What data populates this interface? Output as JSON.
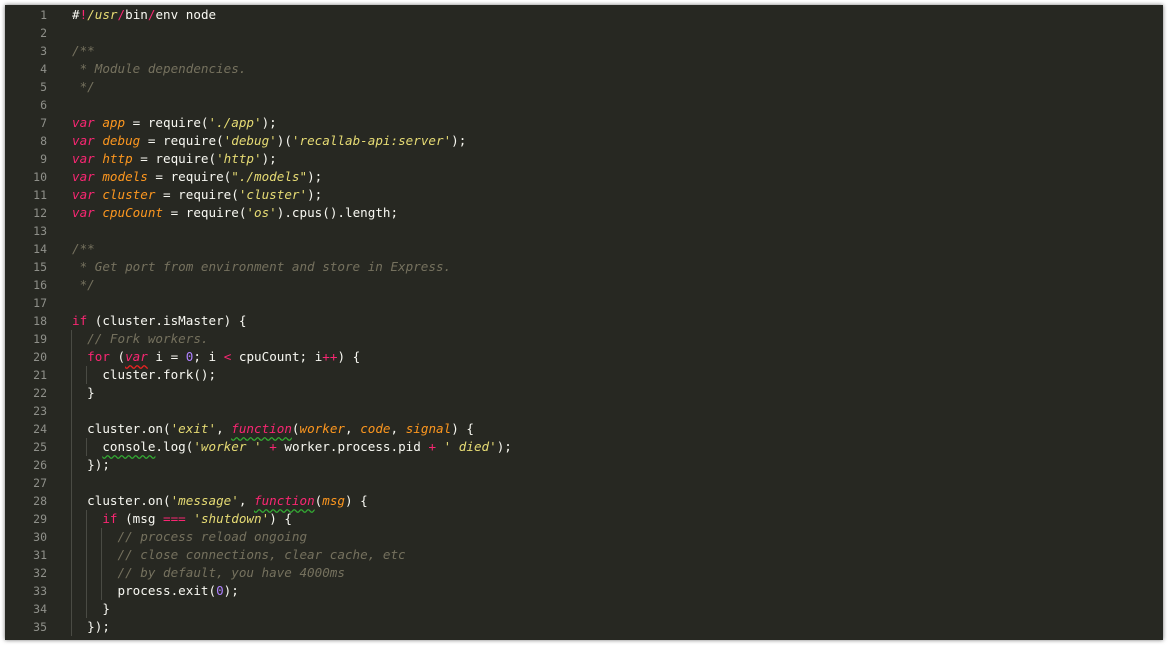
{
  "colors": {
    "background": "#272822",
    "default": "#f8f8f2",
    "keyword": "#f92672",
    "storage": "#f92672",
    "string": "#e6db74",
    "comment": "#75715e",
    "param": "#fd971f",
    "number": "#ae81ff",
    "linenumber": "#8f908a"
  },
  "editor": {
    "lines": [
      {
        "num": "1",
        "tokens": [
          {
            "t": "#",
            "c": "default"
          },
          {
            "t": "!",
            "c": "keyword"
          },
          {
            "t": "/usr",
            "c": "string"
          },
          {
            "t": "/",
            "c": "keyword"
          },
          {
            "t": "bin",
            "c": "default"
          },
          {
            "t": "/",
            "c": "keyword"
          },
          {
            "t": "env node",
            "c": "default"
          }
        ]
      },
      {
        "num": "2",
        "tokens": []
      },
      {
        "num": "3",
        "tokens": [
          {
            "t": "/**",
            "c": "comment"
          }
        ]
      },
      {
        "num": "4",
        "tokens": [
          {
            "t": " * Module dependencies.",
            "c": "comment"
          }
        ]
      },
      {
        "num": "5",
        "tokens": [
          {
            "t": " */",
            "c": "comment"
          }
        ]
      },
      {
        "num": "6",
        "tokens": []
      },
      {
        "num": "7",
        "tokens": [
          {
            "t": "var",
            "c": "storage"
          },
          {
            "t": " ",
            "c": "default"
          },
          {
            "t": "app",
            "c": "param"
          },
          {
            "t": " = require(",
            "c": "default"
          },
          {
            "t": "'./app'",
            "c": "string"
          },
          {
            "t": ");",
            "c": "default"
          }
        ]
      },
      {
        "num": "8",
        "tokens": [
          {
            "t": "var",
            "c": "storage"
          },
          {
            "t": " ",
            "c": "default"
          },
          {
            "t": "debug",
            "c": "param"
          },
          {
            "t": " = require(",
            "c": "default"
          },
          {
            "t": "'debug'",
            "c": "string"
          },
          {
            "t": ")(",
            "c": "default"
          },
          {
            "t": "'recallab-api:server'",
            "c": "string"
          },
          {
            "t": ");",
            "c": "default"
          }
        ]
      },
      {
        "num": "9",
        "tokens": [
          {
            "t": "var",
            "c": "storage"
          },
          {
            "t": " ",
            "c": "default"
          },
          {
            "t": "http",
            "c": "param"
          },
          {
            "t": " = require(",
            "c": "default"
          },
          {
            "t": "'http'",
            "c": "string"
          },
          {
            "t": ");",
            "c": "default"
          }
        ]
      },
      {
        "num": "10",
        "tokens": [
          {
            "t": "var",
            "c": "storage"
          },
          {
            "t": " ",
            "c": "default"
          },
          {
            "t": "models",
            "c": "param"
          },
          {
            "t": " = require(",
            "c": "default"
          },
          {
            "t": "\"./models\"",
            "c": "string"
          },
          {
            "t": ");",
            "c": "default"
          }
        ]
      },
      {
        "num": "11",
        "tokens": [
          {
            "t": "var",
            "c": "storage"
          },
          {
            "t": " ",
            "c": "default"
          },
          {
            "t": "cluster",
            "c": "param"
          },
          {
            "t": " = require(",
            "c": "default"
          },
          {
            "t": "'cluster'",
            "c": "string"
          },
          {
            "t": ");",
            "c": "default"
          }
        ]
      },
      {
        "num": "12",
        "tokens": [
          {
            "t": "var",
            "c": "storage"
          },
          {
            "t": " ",
            "c": "default"
          },
          {
            "t": "cpuCount",
            "c": "param"
          },
          {
            "t": " = require(",
            "c": "default"
          },
          {
            "t": "'os'",
            "c": "string"
          },
          {
            "t": ").cpus().length;",
            "c": "default"
          }
        ]
      },
      {
        "num": "13",
        "tokens": []
      },
      {
        "num": "14",
        "tokens": [
          {
            "t": "/**",
            "c": "comment"
          }
        ]
      },
      {
        "num": "15",
        "tokens": [
          {
            "t": " * Get port from environment and store in Express.",
            "c": "comment"
          }
        ]
      },
      {
        "num": "16",
        "tokens": [
          {
            "t": " */",
            "c": "comment"
          }
        ]
      },
      {
        "num": "17",
        "tokens": []
      },
      {
        "num": "18",
        "tokens": [
          {
            "t": "if",
            "c": "keyword"
          },
          {
            "t": " (cluster.isMaster) {",
            "c": "default"
          }
        ]
      },
      {
        "num": "19",
        "tokens": [
          {
            "t": "  ",
            "c": "default"
          },
          {
            "t": "// Fork workers.",
            "c": "comment"
          }
        ]
      },
      {
        "num": "20",
        "tokens": [
          {
            "t": "  ",
            "c": "default"
          },
          {
            "t": "for",
            "c": "keyword"
          },
          {
            "t": " (",
            "c": "default"
          },
          {
            "t": "var",
            "c": "storage",
            "s": "r"
          },
          {
            "t": " i = ",
            "c": "default"
          },
          {
            "t": "0",
            "c": "number"
          },
          {
            "t": "; i ",
            "c": "default"
          },
          {
            "t": "<",
            "c": "keyword"
          },
          {
            "t": " cpuCount; i",
            "c": "default"
          },
          {
            "t": "++",
            "c": "keyword"
          },
          {
            "t": ") {",
            "c": "default"
          }
        ]
      },
      {
        "num": "21",
        "tokens": [
          {
            "t": "    cluster.fork();",
            "c": "default"
          }
        ]
      },
      {
        "num": "22",
        "tokens": [
          {
            "t": "  }",
            "c": "default"
          }
        ]
      },
      {
        "num": "23",
        "tokens": []
      },
      {
        "num": "24",
        "tokens": [
          {
            "t": "  cluster.on(",
            "c": "default"
          },
          {
            "t": "'exit'",
            "c": "string"
          },
          {
            "t": ", ",
            "c": "default"
          },
          {
            "t": "function",
            "c": "storage",
            "s": "g"
          },
          {
            "t": "(",
            "c": "default"
          },
          {
            "t": "worker",
            "c": "param"
          },
          {
            "t": ", ",
            "c": "default"
          },
          {
            "t": "code",
            "c": "param"
          },
          {
            "t": ", ",
            "c": "default"
          },
          {
            "t": "signal",
            "c": "param"
          },
          {
            "t": ") {",
            "c": "default"
          }
        ]
      },
      {
        "num": "25",
        "tokens": [
          {
            "t": "    ",
            "c": "default"
          },
          {
            "t": "console",
            "c": "default",
            "s": "g"
          },
          {
            "t": ".log(",
            "c": "default"
          },
          {
            "t": "'worker '",
            "c": "string"
          },
          {
            "t": " ",
            "c": "default"
          },
          {
            "t": "+",
            "c": "keyword"
          },
          {
            "t": " worker.process.pid ",
            "c": "default"
          },
          {
            "t": "+",
            "c": "keyword"
          },
          {
            "t": " ",
            "c": "default"
          },
          {
            "t": "' died'",
            "c": "string"
          },
          {
            "t": ");",
            "c": "default"
          }
        ]
      },
      {
        "num": "26",
        "tokens": [
          {
            "t": "  });",
            "c": "default"
          }
        ]
      },
      {
        "num": "27",
        "tokens": []
      },
      {
        "num": "28",
        "tokens": [
          {
            "t": "  cluster.on(",
            "c": "default"
          },
          {
            "t": "'message'",
            "c": "string"
          },
          {
            "t": ", ",
            "c": "default"
          },
          {
            "t": "function",
            "c": "storage",
            "s": "g"
          },
          {
            "t": "(",
            "c": "default"
          },
          {
            "t": "msg",
            "c": "param"
          },
          {
            "t": ") {",
            "c": "default"
          }
        ]
      },
      {
        "num": "29",
        "tokens": [
          {
            "t": "    ",
            "c": "default"
          },
          {
            "t": "if",
            "c": "keyword"
          },
          {
            "t": " (msg ",
            "c": "default"
          },
          {
            "t": "===",
            "c": "keyword"
          },
          {
            "t": " ",
            "c": "default"
          },
          {
            "t": "'shutdown'",
            "c": "string"
          },
          {
            "t": ") {",
            "c": "default"
          }
        ]
      },
      {
        "num": "30",
        "tokens": [
          {
            "t": "      ",
            "c": "default"
          },
          {
            "t": "// process reload ongoing",
            "c": "comment"
          }
        ]
      },
      {
        "num": "31",
        "tokens": [
          {
            "t": "      ",
            "c": "default"
          },
          {
            "t": "// close connections, clear cache, etc",
            "c": "comment"
          }
        ]
      },
      {
        "num": "32",
        "tokens": [
          {
            "t": "      ",
            "c": "default"
          },
          {
            "t": "// by default, you have 4000ms",
            "c": "comment"
          }
        ]
      },
      {
        "num": "33",
        "tokens": [
          {
            "t": "      process.exit(",
            "c": "default"
          },
          {
            "t": "0",
            "c": "number"
          },
          {
            "t": ");",
            "c": "default"
          }
        ]
      },
      {
        "num": "34",
        "tokens": [
          {
            "t": "    }",
            "c": "default"
          }
        ]
      },
      {
        "num": "35",
        "tokens": [
          {
            "t": "  });",
            "c": "default"
          }
        ]
      }
    ]
  }
}
